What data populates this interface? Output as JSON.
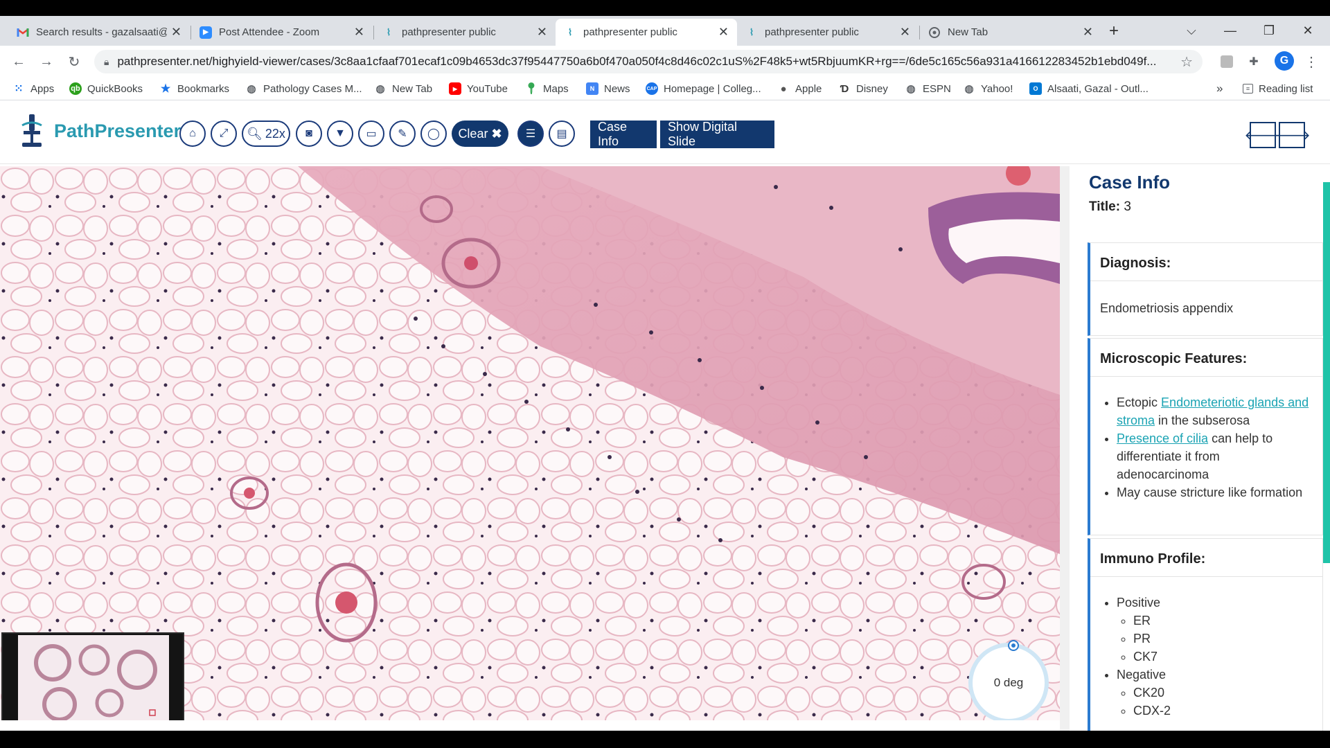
{
  "browser": {
    "tabs": [
      {
        "title": "Search results - gazalsaati@",
        "icon": "gmail-icon",
        "active": false
      },
      {
        "title": "Post Attendee - Zoom",
        "icon": "zoom-icon",
        "active": false
      },
      {
        "title": "pathpresenter public",
        "icon": "pathpresenter-icon",
        "active": false
      },
      {
        "title": "pathpresenter public",
        "icon": "pathpresenter-icon",
        "active": true
      },
      {
        "title": "pathpresenter public",
        "icon": "pathpresenter-icon",
        "active": false
      },
      {
        "title": "New Tab",
        "icon": "chrome-icon",
        "active": false
      }
    ],
    "url": "pathpresenter.net/highyield-viewer/cases/3c8aa1cfaaf701ecaf1c09b4653dc37f95447750a6b0f470a050f4c8d46c02c1uS%2F48k5+wt5RbjuumKR+rg==/6de5c165c56a931a416612283452b1ebd049f...",
    "avatar_letter": "G",
    "bookmarks": [
      {
        "label": "Apps",
        "icon": "apps-grid-icon",
        "color": "#1a73e8"
      },
      {
        "label": "QuickBooks",
        "icon": "quickbooks-icon",
        "color": "#2ca01c"
      },
      {
        "label": "Bookmarks",
        "icon": "star-icon",
        "color": "#1a73e8"
      },
      {
        "label": "Pathology Cases M...",
        "icon": "globe-icon",
        "color": "#5f6368"
      },
      {
        "label": "New Tab",
        "icon": "globe-icon",
        "color": "#5f6368"
      },
      {
        "label": "YouTube",
        "icon": "youtube-icon",
        "color": "#ff0000"
      },
      {
        "label": "Maps",
        "icon": "maps-pin-icon",
        "color": "#34a853"
      },
      {
        "label": "News",
        "icon": "news-icon",
        "color": "#4285f4"
      },
      {
        "label": "Homepage | Colleg...",
        "icon": "cap-icon",
        "color": "#1a73e8"
      },
      {
        "label": "Apple",
        "icon": "apple-icon",
        "color": "#555555"
      },
      {
        "label": "Disney",
        "icon": "disney-icon",
        "color": "#333333"
      },
      {
        "label": "ESPN",
        "icon": "globe-icon",
        "color": "#5f6368"
      },
      {
        "label": "Yahoo!",
        "icon": "globe-icon",
        "color": "#5f6368"
      },
      {
        "label": "Alsaati, Gazal - Outl...",
        "icon": "outlook-icon",
        "color": "#0078d4"
      }
    ],
    "bookmarks_overflow": "»",
    "reading_list": "Reading list"
  },
  "app": {
    "brand": "PathPresenter",
    "zoom_label": "22x",
    "clear_label": "Clear",
    "case_info_button": "Case Info",
    "show_slide_button": "Show Digital Slide",
    "accent": "#12386e",
    "brand_color": "#2a9ab0"
  },
  "viewer": {
    "rotation_label": "0 deg"
  },
  "panel": {
    "title": "Case Info",
    "case_title_label": "Title:",
    "case_title_value": "3",
    "diagnosis": {
      "heading": "Diagnosis:",
      "text": "Endometriosis appendix"
    },
    "microscopic": {
      "heading": "Microscopic Features:",
      "item1_prefix": "Ectopic",
      "item1_link": "Endometeriotic glands and stroma",
      "item1_suffix": "in the subserosa",
      "item2_link": "Presence of cilia",
      "item2_suffix": "can help to differentiate it from adenocarcinoma",
      "item3": "May cause stricture like formation"
    },
    "immuno": {
      "heading": "Immuno Profile:",
      "positive_label": "Positive",
      "positive": [
        "ER",
        "PR",
        "CK7"
      ],
      "negative_label": "Negative",
      "negative": [
        "CK20",
        "CDX-2"
      ]
    }
  }
}
